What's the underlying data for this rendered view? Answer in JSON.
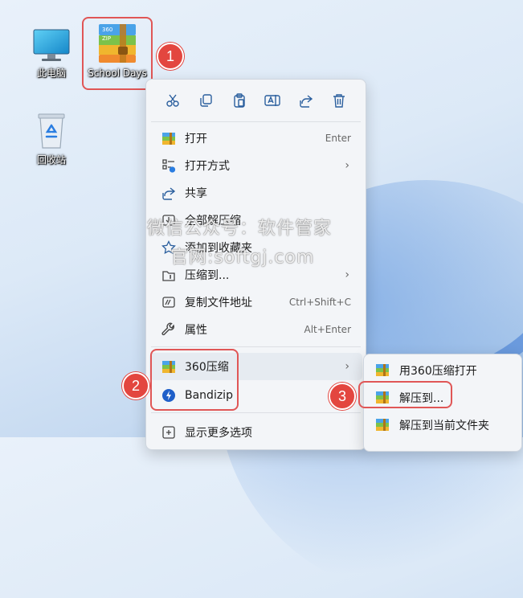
{
  "desktop": {
    "icons": [
      {
        "label": "此电脑",
        "icon": "monitor-icon"
      },
      {
        "label": "School Days",
        "icon": "360zip-archive-icon"
      },
      {
        "label": "回收站",
        "icon": "recycle-bin-icon"
      }
    ]
  },
  "zip_icon_text": {
    "line1": "360",
    "line2": "ZIP"
  },
  "badges": [
    "1",
    "2",
    "3"
  ],
  "context_menu": {
    "toolbar": [
      {
        "icon": "cut-icon"
      },
      {
        "icon": "copy-icon"
      },
      {
        "icon": "paste-icon"
      },
      {
        "icon": "rename-icon"
      },
      {
        "icon": "share-icon"
      },
      {
        "icon": "delete-icon"
      }
    ],
    "items": [
      {
        "label": "打开",
        "shortcut": "Enter"
      },
      {
        "label": "打开方式",
        "submenu": true
      },
      {
        "label": "共享"
      },
      {
        "label": "全部解压缩"
      },
      {
        "label": "添加到收藏夹"
      },
      {
        "label": "压缩到...",
        "submenu": true
      },
      {
        "label": "复制文件地址",
        "shortcut": "Ctrl+Shift+C"
      },
      {
        "label": "属性",
        "shortcut": "Alt+Enter"
      },
      {
        "label": "360压缩",
        "submenu": true
      },
      {
        "label": "Bandizip"
      },
      {
        "label": "显示更多选项"
      }
    ],
    "arrow": "›"
  },
  "submenu_360": {
    "items": [
      {
        "label": "用360压缩打开"
      },
      {
        "label": "解压到..."
      },
      {
        "label": "解压到当前文件夹"
      }
    ]
  },
  "watermark": {
    "line1": "微信公众号：软件管家",
    "line2": "官网:softgj.com"
  },
  "colors": {
    "highlight": "#e05656",
    "badge": "#e3463f",
    "accent": "#2a7de1"
  }
}
